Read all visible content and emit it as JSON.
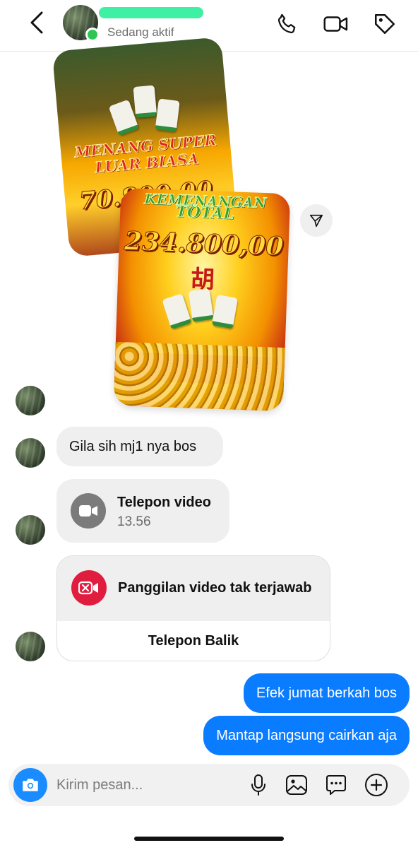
{
  "header": {
    "status": "Sedang aktif"
  },
  "images": {
    "back_card_line1": "MENANG SUPER",
    "back_card_line2": "LUAR BIASA",
    "back_card_amount": "70.800,00",
    "front_card_line1": "KEMENANGAN",
    "front_card_line2": "TOTAL",
    "front_card_amount": "234.800,00",
    "front_card_glyph": "胡"
  },
  "messages": {
    "incoming_text": "Gila sih mj1 nya bos",
    "video_call_title": "Telepon video",
    "video_call_time": "13.56",
    "missed_call_title": "Panggilan video tak terjawab",
    "call_back_label": "Telepon Balik",
    "outgoing_1": "Efek jumat berkah bos",
    "outgoing_2": "Mantap langsung cairkan aja"
  },
  "composer": {
    "placeholder": "Kirim pesan..."
  },
  "colors": {
    "accent": "#0a7cff",
    "online": "#2dc653",
    "missed": "#e11d3f"
  }
}
